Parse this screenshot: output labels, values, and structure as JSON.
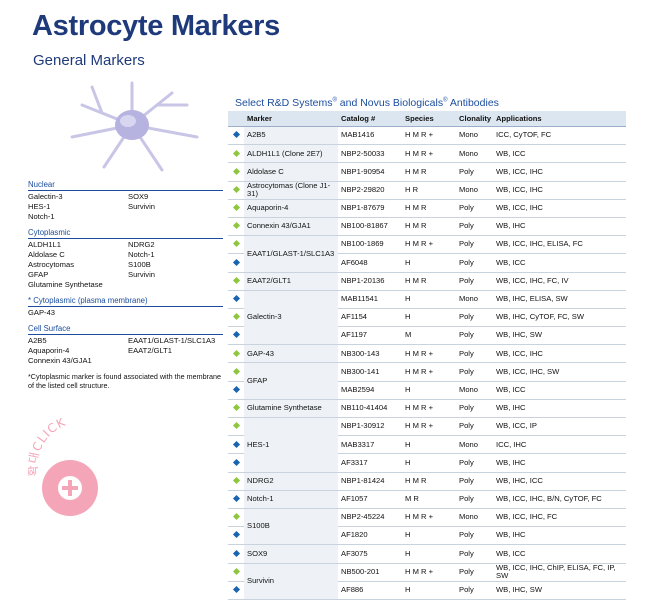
{
  "header": {
    "title": "Astrocyte Markers",
    "subtitle": "General Markers"
  },
  "legend": {
    "sections": [
      {
        "title": "Nuclear",
        "items": [
          "Galectin-3",
          "SOX9",
          "HES-1",
          "Survivin",
          "Notch-1",
          ""
        ]
      },
      {
        "title": "Cytoplasmic",
        "items": [
          "ALDH1L1",
          "NDRG2",
          "Aldolase C",
          "Notch-1",
          "Astrocytomas",
          "S100B",
          "GFAP",
          "Survivin",
          "Glutamine Synthetase",
          ""
        ]
      },
      {
        "title": "* Cytoplasmic (plasma membrane)",
        "items": [
          "GAP-43",
          ""
        ]
      },
      {
        "title": "Cell Surface",
        "items": [
          "A2B5",
          "EAAT1/GLAST-1/SLC1A3",
          "Aquaporin-4",
          "EAAT2/GLT1",
          "Connexin 43/GJA1",
          ""
        ]
      }
    ],
    "footnote": "*Cytoplasmic marker is found associated with the membrane of the listed cell structure."
  },
  "table": {
    "heading_pre": "Select R&D Systems",
    "heading_mid": " and Novus Biologicals",
    "heading_post": "  Antibodies",
    "reg": "®",
    "columns": [
      "",
      "Marker",
      "Catalog #",
      "Species",
      "Clonality",
      "Applications"
    ]
  },
  "colors": {
    "title": "#1f3a7a",
    "green_dot": "#8dc63f",
    "blue_dot": "#1a63b0",
    "badge": "#f4a6b8"
  },
  "badge": {
    "text": "확대CLICK",
    "icon": "plus-icon"
  },
  "rows": [
    {
      "dot": "blue",
      "marker": "A2B5",
      "span": 1,
      "catalog": "MAB1416",
      "species": "H M R +",
      "clonality": "Mono",
      "apps": "ICC, CyTOF, FC"
    },
    {
      "dot": "green",
      "marker": "ALDH1L1 (Clone 2E7)",
      "span": 1,
      "catalog": "NBP2-50033",
      "species": "H M R +",
      "clonality": "Mono",
      "apps": "WB, ICC"
    },
    {
      "dot": "green",
      "marker": "Aldolase C",
      "span": 1,
      "catalog": "NBP1-90954",
      "species": "H M R",
      "clonality": "Poly",
      "apps": "WB, ICC, IHC"
    },
    {
      "dot": "green",
      "marker": "Astrocytomas (Clone J1-31)",
      "span": 1,
      "catalog": "NBP2-29820",
      "species": "H R",
      "clonality": "Mono",
      "apps": "WB, ICC, IHC"
    },
    {
      "dot": "green",
      "marker": "Aquaporin-4",
      "span": 1,
      "catalog": "NBP1-87679",
      "species": "H M R",
      "clonality": "Poly",
      "apps": "WB, ICC, IHC"
    },
    {
      "dot": "green",
      "marker": "Connexin 43/GJA1",
      "span": 1,
      "catalog": "NB100-81867",
      "species": "H M R",
      "clonality": "Poly",
      "apps": "WB, IHC"
    },
    {
      "dot": "green",
      "marker": "EAAT1/GLAST-1/SLC1A3",
      "span": 2,
      "catalog": "NB100-1869",
      "species": "H M R +",
      "clonality": "Poly",
      "apps": "WB, ICC, IHC, ELISA, FC"
    },
    {
      "dot": "blue",
      "marker": null,
      "catalog": "AF6048",
      "species": "H",
      "clonality": "Poly",
      "apps": "WB, ICC"
    },
    {
      "dot": "green",
      "marker": "EAAT2/GLT1",
      "span": 1,
      "catalog": "NBP1-20136",
      "species": "H M R",
      "clonality": "Poly",
      "apps": "WB, ICC, IHC, FC, IV"
    },
    {
      "dot": "blue",
      "marker": "Galectin-3",
      "span": 3,
      "catalog": "MAB11541",
      "species": "H",
      "clonality": "Mono",
      "apps": "WB, IHC, ELISA, SW"
    },
    {
      "dot": "green",
      "marker": null,
      "catalog": "AF1154",
      "species": "H",
      "clonality": "Poly",
      "apps": "WB, IHC, CyTOF, FC, SW"
    },
    {
      "dot": "blue",
      "marker": null,
      "catalog": "AF1197",
      "species": "M",
      "clonality": "Poly",
      "apps": "WB, IHC, SW"
    },
    {
      "dot": "green",
      "marker": "GAP-43",
      "span": 1,
      "catalog": "NB300-143",
      "species": "H M R +",
      "clonality": "Poly",
      "apps": "WB, ICC, IHC"
    },
    {
      "dot": "green",
      "marker": "GFAP",
      "span": 2,
      "catalog": "NB300-141",
      "species": "H M R +",
      "clonality": "Poly",
      "apps": "WB, ICC, IHC, SW"
    },
    {
      "dot": "blue",
      "marker": null,
      "catalog": "MAB2594",
      "species": "H",
      "clonality": "Mono",
      "apps": "WB, ICC"
    },
    {
      "dot": "green",
      "marker": "Glutamine Synthetase",
      "span": 1,
      "catalog": "NB110-41404",
      "species": "H M R +",
      "clonality": "Poly",
      "apps": "WB, IHC"
    },
    {
      "dot": "green",
      "marker": "HES-1",
      "span": 3,
      "catalog": "NBP1-30912",
      "species": "H M R +",
      "clonality": "Poly",
      "apps": "WB, ICC, IP"
    },
    {
      "dot": "blue",
      "marker": null,
      "catalog": "MAB3317",
      "species": "H",
      "clonality": "Mono",
      "apps": "ICC, IHC"
    },
    {
      "dot": "blue",
      "marker": null,
      "catalog": "AF3317",
      "species": "H",
      "clonality": "Poly",
      "apps": "WB, IHC"
    },
    {
      "dot": "green",
      "marker": "NDRG2",
      "span": 1,
      "catalog": "NBP1-81424",
      "species": "H M R",
      "clonality": "Poly",
      "apps": "WB, IHC, ICC"
    },
    {
      "dot": "blue",
      "marker": "Notch-1",
      "span": 1,
      "catalog": "AF1057",
      "species": "M R",
      "clonality": "Poly",
      "apps": "WB, ICC, IHC, B/N, CyTOF, FC"
    },
    {
      "dot": "green",
      "marker": "S100B",
      "span": 2,
      "catalog": "NBP2-45224",
      "species": "H M R +",
      "clonality": "Mono",
      "apps": "WB, ICC, IHC, FC"
    },
    {
      "dot": "blue",
      "marker": null,
      "catalog": "AF1820",
      "species": "H",
      "clonality": "Poly",
      "apps": "WB, IHC"
    },
    {
      "dot": "blue",
      "marker": "SOX9",
      "span": 1,
      "catalog": "AF3075",
      "species": "H",
      "clonality": "Poly",
      "apps": "WB, ICC"
    },
    {
      "dot": "green",
      "marker": "Survivin",
      "span": 2,
      "catalog": "NB500-201",
      "species": "H M R +",
      "clonality": "Poly",
      "apps": "WB, ICC, IHC, ChIP, ELISA, FC, IP, SW"
    },
    {
      "dot": "blue",
      "marker": null,
      "catalog": "AF886",
      "species": "H",
      "clonality": "Poly",
      "apps": "WB, IHC, SW"
    }
  ]
}
